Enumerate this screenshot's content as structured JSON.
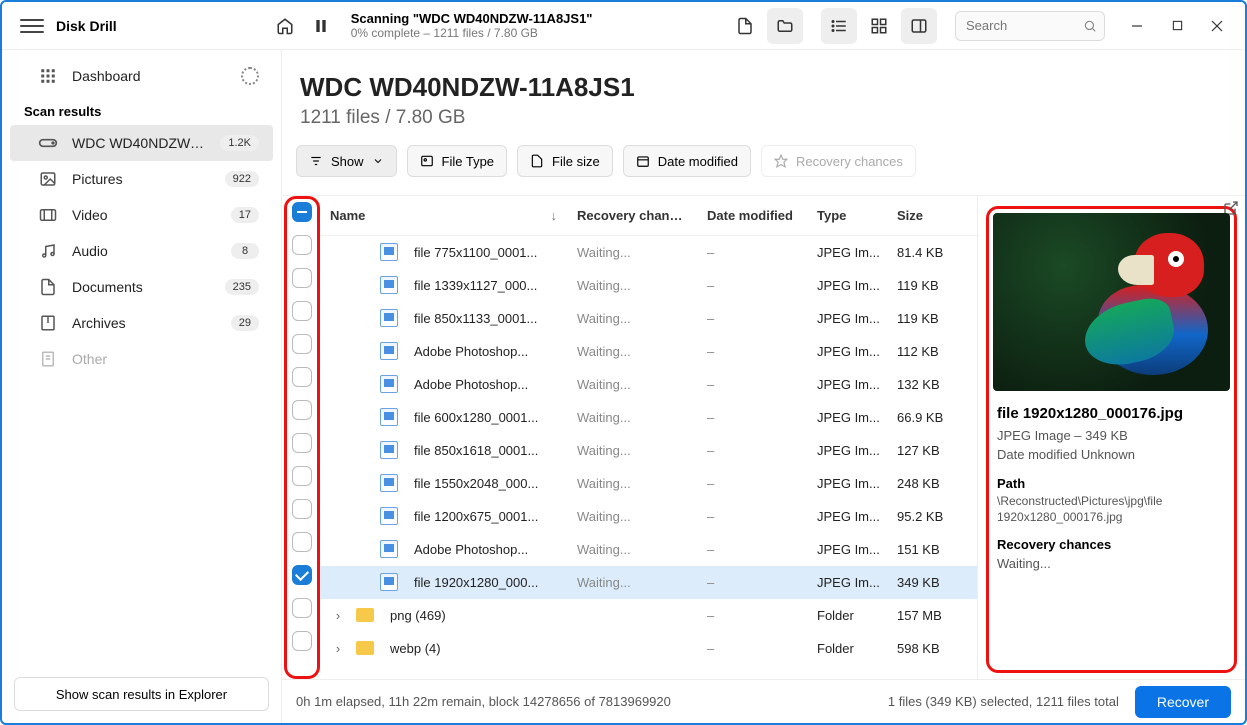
{
  "app": {
    "title": "Disk Drill"
  },
  "topbar": {
    "scan_title": "Scanning \"WDC WD40NDZW-11A8JS1\"",
    "scan_sub": "0% complete – 1211 files / 7.80 GB",
    "search_placeholder": "Search"
  },
  "sidebar": {
    "dashboard": "Dashboard",
    "scan_results": "Scan results",
    "items": [
      {
        "label": "WDC WD40NDZW-11A...",
        "badge": "1.2K"
      },
      {
        "label": "Pictures",
        "badge": "922"
      },
      {
        "label": "Video",
        "badge": "17"
      },
      {
        "label": "Audio",
        "badge": "8"
      },
      {
        "label": "Documents",
        "badge": "235"
      },
      {
        "label": "Archives",
        "badge": "29"
      },
      {
        "label": "Other",
        "badge": ""
      }
    ],
    "footer_btn": "Show scan results in Explorer"
  },
  "main": {
    "title": "WDC WD40NDZW-11A8JS1",
    "subtitle": "1211 files / 7.80 GB"
  },
  "filters": {
    "show": "Show",
    "file_type": "File Type",
    "file_size": "File size",
    "date_modified": "Date modified",
    "recovery": "Recovery chances"
  },
  "table": {
    "headers": {
      "name": "Name",
      "rec": "Recovery chances",
      "date": "Date modified",
      "type": "Type",
      "size": "Size"
    },
    "rows": [
      {
        "name": "file 775x1100_0001...",
        "rec": "Waiting...",
        "date": "–",
        "type": "JPEG Im...",
        "size": "81.4 KB",
        "kind": "file",
        "selected": false
      },
      {
        "name": "file 1339x1127_000...",
        "rec": "Waiting...",
        "date": "–",
        "type": "JPEG Im...",
        "size": "119 KB",
        "kind": "file",
        "selected": false
      },
      {
        "name": "file 850x1133_0001...",
        "rec": "Waiting...",
        "date": "–",
        "type": "JPEG Im...",
        "size": "119 KB",
        "kind": "file",
        "selected": false
      },
      {
        "name": "Adobe Photoshop...",
        "rec": "Waiting...",
        "date": "–",
        "type": "JPEG Im...",
        "size": "112 KB",
        "kind": "file",
        "selected": false
      },
      {
        "name": "Adobe Photoshop...",
        "rec": "Waiting...",
        "date": "–",
        "type": "JPEG Im...",
        "size": "132 KB",
        "kind": "file",
        "selected": false
      },
      {
        "name": "file 600x1280_0001...",
        "rec": "Waiting...",
        "date": "–",
        "type": "JPEG Im...",
        "size": "66.9 KB",
        "kind": "file",
        "selected": false
      },
      {
        "name": "file 850x1618_0001...",
        "rec": "Waiting...",
        "date": "–",
        "type": "JPEG Im...",
        "size": "127 KB",
        "kind": "file",
        "selected": false
      },
      {
        "name": "file 1550x2048_000...",
        "rec": "Waiting...",
        "date": "–",
        "type": "JPEG Im...",
        "size": "248 KB",
        "kind": "file",
        "selected": false
      },
      {
        "name": "file 1200x675_0001...",
        "rec": "Waiting...",
        "date": "–",
        "type": "JPEG Im...",
        "size": "95.2 KB",
        "kind": "file",
        "selected": false
      },
      {
        "name": "Adobe Photoshop...",
        "rec": "Waiting...",
        "date": "–",
        "type": "JPEG Im...",
        "size": "151 KB",
        "kind": "file",
        "selected": false
      },
      {
        "name": "file 1920x1280_000...",
        "rec": "Waiting...",
        "date": "–",
        "type": "JPEG Im...",
        "size": "349 KB",
        "kind": "file",
        "selected": true
      },
      {
        "name": "png (469)",
        "rec": "",
        "date": "–",
        "type": "Folder",
        "size": "157 MB",
        "kind": "folder",
        "selected": false
      },
      {
        "name": "webp (4)",
        "rec": "",
        "date": "–",
        "type": "Folder",
        "size": "598 KB",
        "kind": "folder",
        "selected": false
      }
    ]
  },
  "preview": {
    "filename": "file 1920x1280_000176.jpg",
    "meta": "JPEG Image – 349 KB",
    "date": "Date modified Unknown",
    "path_label": "Path",
    "path": "\\Reconstructed\\Pictures\\jpg\\file 1920x1280_000176.jpg",
    "rec_label": "Recovery chances",
    "rec_value": "Waiting..."
  },
  "status": {
    "left": "0h 1m elapsed, 11h 22m remain, block 14278656 of 7813969920",
    "right": "1 files (349 KB) selected, 1211 files total",
    "recover": "Recover"
  }
}
